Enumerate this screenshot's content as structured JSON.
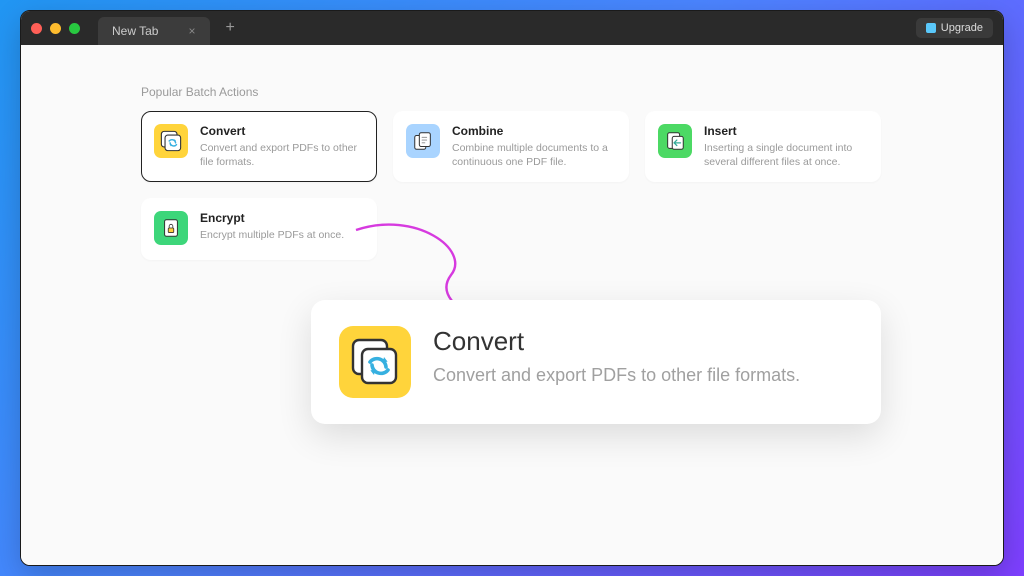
{
  "titlebar": {
    "tab_label": "New Tab",
    "upgrade_label": "Upgrade"
  },
  "section": {
    "title": "Popular Batch Actions"
  },
  "cards": [
    {
      "title": "Convert",
      "desc": "Convert and export PDFs to other file formats."
    },
    {
      "title": "Combine",
      "desc": "Combine multiple documents to a continuous one PDF file."
    },
    {
      "title": "Insert",
      "desc": "Inserting a single document into several different files at once."
    },
    {
      "title": "Encrypt",
      "desc": "Encrypt multiple PDFs at once."
    }
  ],
  "detail": {
    "title": "Convert",
    "desc": "Convert and export PDFs to other file formats."
  }
}
